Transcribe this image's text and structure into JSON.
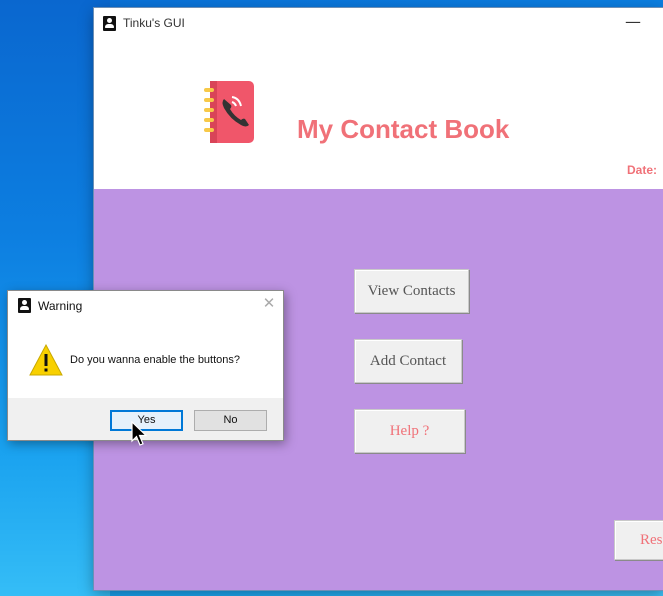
{
  "main_window": {
    "title": "Tinku's GUI",
    "minimize_glyph": "—",
    "header": {
      "title": "My Contact Book",
      "date_label": "Date:"
    },
    "buttons": {
      "view": "View Contacts",
      "add": "Add Contact",
      "help": "Help ?",
      "reset": "Res"
    }
  },
  "dialog": {
    "title": "Warning",
    "close_glyph": "✕",
    "message": "Do you wanna enable the buttons?",
    "yes_label": "Yes",
    "no_label": "No"
  },
  "colors": {
    "accent_pink": "#f07178",
    "content_purple": "#bd93e3",
    "focus_blue": "#0078d7"
  }
}
